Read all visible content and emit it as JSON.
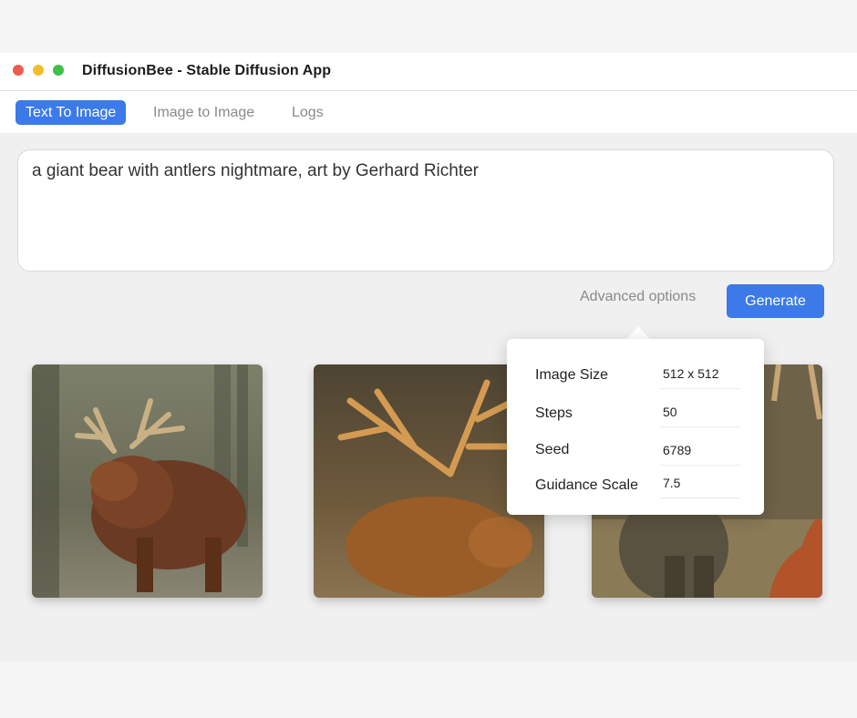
{
  "window": {
    "title": "DiffusionBee - Stable Diffusion App"
  },
  "tabs": [
    {
      "label": "Text To Image",
      "active": true
    },
    {
      "label": "Image to Image",
      "active": false
    },
    {
      "label": "Logs",
      "active": false
    }
  ],
  "prompt": {
    "value": "a giant bear with antlers nightmare, art by Gerhard Richter"
  },
  "actions": {
    "advanced_label": "Advanced options",
    "generate_label": "Generate"
  },
  "advanced_options": [
    {
      "label": "Image Size",
      "value": "512 x 512"
    },
    {
      "label": "Steps",
      "value": "50"
    },
    {
      "label": "Seed",
      "value": "6789"
    },
    {
      "label": "Guidance Scale",
      "value": "7.5"
    }
  ],
  "generated_images": [
    {
      "icon": "generated-image-1"
    },
    {
      "icon": "generated-image-2"
    },
    {
      "icon": "generated-image-3"
    }
  ],
  "colors": {
    "accent": "#3b7ae8",
    "close": "#ed5a4f",
    "minimize": "#f3be2e",
    "maximize": "#3ebf4a"
  }
}
